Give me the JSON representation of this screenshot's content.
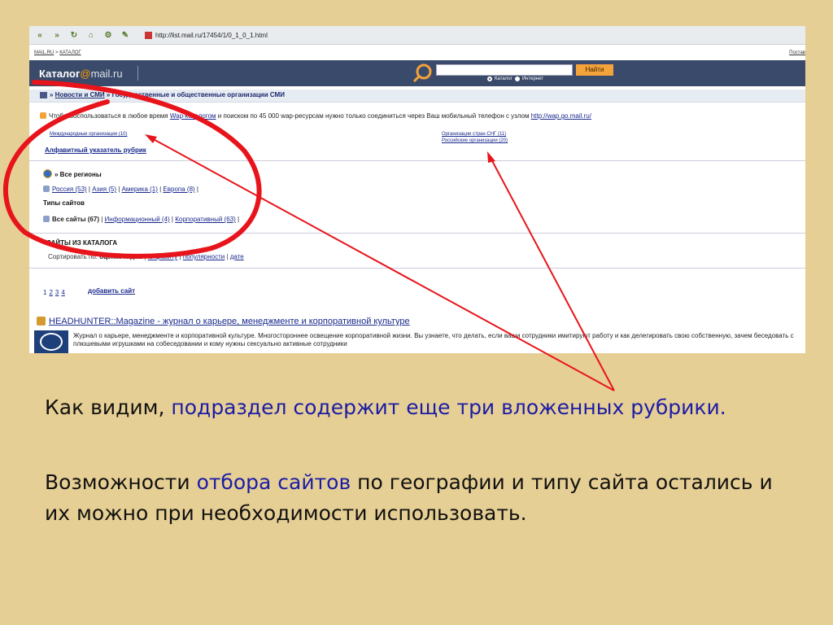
{
  "browser": {
    "url": "http://list.mail.ru/17454/1/0_1_0_1.html"
  },
  "topline": {
    "crumb_left_1": "MAIL.RU",
    "crumb_sep": " > ",
    "crumb_left_2": "КАТАЛОГ",
    "right_link": "Постав"
  },
  "header": {
    "logo_text": "Каталог",
    "logo_at": "@",
    "logo_domain": "mail.ru",
    "search_button": "Найти",
    "radio_catalog": "Каталог",
    "radio_internet": "Интернет"
  },
  "breadcrumb": {
    "prefix": "» ",
    "item1": "Новости и СМИ",
    "sep": " » ",
    "item2": "Государственные и общественные организации СМИ"
  },
  "wap": {
    "text1": "Чтобы воспользоваться в любое время ",
    "link1": "Wap-каталогом",
    "text2": " и поиском по 45 000 wap-ресурсам нужно только соединиться через Ваш мобильный телефон с узлом ",
    "link2": "http://wap.go.mail.ru/"
  },
  "subrubrics": [
    {
      "label": "Международные организации (10)"
    },
    {
      "label": "Организации стран СНГ (11)"
    },
    {
      "label": "Российские организации (20)"
    }
  ],
  "alphabet_link": "Алфавитный указатель рубрик",
  "regions": {
    "title": "» Все регионы",
    "links": [
      "Россия (53)",
      "Азия (5)",
      "Америка (1)",
      "Европа (8)"
    ],
    "sep": " | "
  },
  "types": {
    "title": "Типы сайтов",
    "all": "Все сайты (67)",
    "links": [
      "Информационный (4)",
      "Корпоративный (63)"
    ],
    "sep": " | "
  },
  "catalog": {
    "title": "САЙТЫ ИЗ КАТАЛОГА",
    "sort_prefix": "Сортировать по: ",
    "sort_current": "оценке гидов",
    "sort_links": [
      "алфавиту",
      "популярности",
      "дате"
    ],
    "sep": " | "
  },
  "pager": {
    "pages": [
      "1",
      "2",
      "3",
      "4"
    ],
    "add_site": "добавить сайт"
  },
  "result": {
    "title": "HEADHUNTER::Magazine - журнал о карьере, менеджменте и корпоративной культуре",
    "description": "Журнал о карьере, менеджменте и корпоративной культуре. Многостороннее освещение корпоративной жизни. Вы узнаете, что делать, если ваши сотрудники имитируют работу и как делегировать свою собственную, зачем беседовать с плюшевыми игрушками на собеседовании и кому нужны сексуально активные сотрудники"
  },
  "caption": {
    "line1_a": "Как видим, ",
    "line1_b": "подраздел содержит еще три вложенных рубрики.",
    "line2_a": "Возможности ",
    "line2_b": "отбора сайтов",
    "line2_c": " по географии и типу сайта остались и их можно при необходимости использовать."
  },
  "colors": {
    "background": "#e6cf94",
    "annotation": "#e8141b",
    "highlight_text": "#1c1ca6",
    "header": "#3a4a6a"
  }
}
